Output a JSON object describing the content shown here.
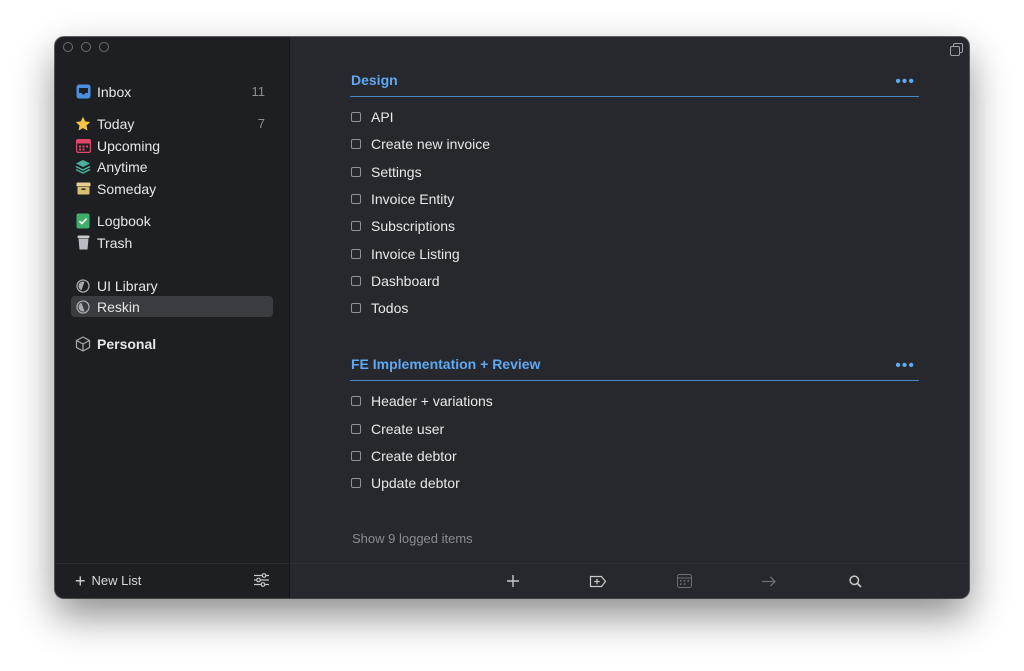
{
  "sidebar": {
    "items": [
      {
        "label": "Inbox",
        "count": "11",
        "icon": "inbox-icon"
      },
      {
        "label": "Today",
        "count": "7",
        "icon": "star-icon"
      },
      {
        "label": "Upcoming",
        "icon": "calendar-icon"
      },
      {
        "label": "Anytime",
        "icon": "layers-icon"
      },
      {
        "label": "Someday",
        "icon": "archive-box-icon"
      },
      {
        "label": "Logbook",
        "icon": "logbook-icon"
      },
      {
        "label": "Trash",
        "icon": "trash-icon"
      },
      {
        "label": "UI Library",
        "icon": "project-pie-icon"
      },
      {
        "label": "Reskin",
        "icon": "project-pie-icon",
        "selected": true
      },
      {
        "label": "Personal",
        "icon": "area-cube-icon"
      }
    ],
    "new_list_label": "New List"
  },
  "main": {
    "sections": [
      {
        "title": "Design",
        "todos": [
          "API",
          "Create new invoice",
          "Settings",
          "Invoice Entity",
          "Subscriptions",
          "Invoice Listing",
          "Dashboard",
          "Todos"
        ]
      },
      {
        "title": "FE Implementation + Review",
        "todos": [
          "Header + variations",
          "Create user",
          "Create debtor",
          "Update debtor"
        ]
      }
    ],
    "show_logged": "Show 9 logged items",
    "more_glyph": "•••"
  },
  "colors": {
    "accent": "#5fa8f2",
    "sidebar_bg": "#1d1f23",
    "main_bg": "#26282d"
  }
}
